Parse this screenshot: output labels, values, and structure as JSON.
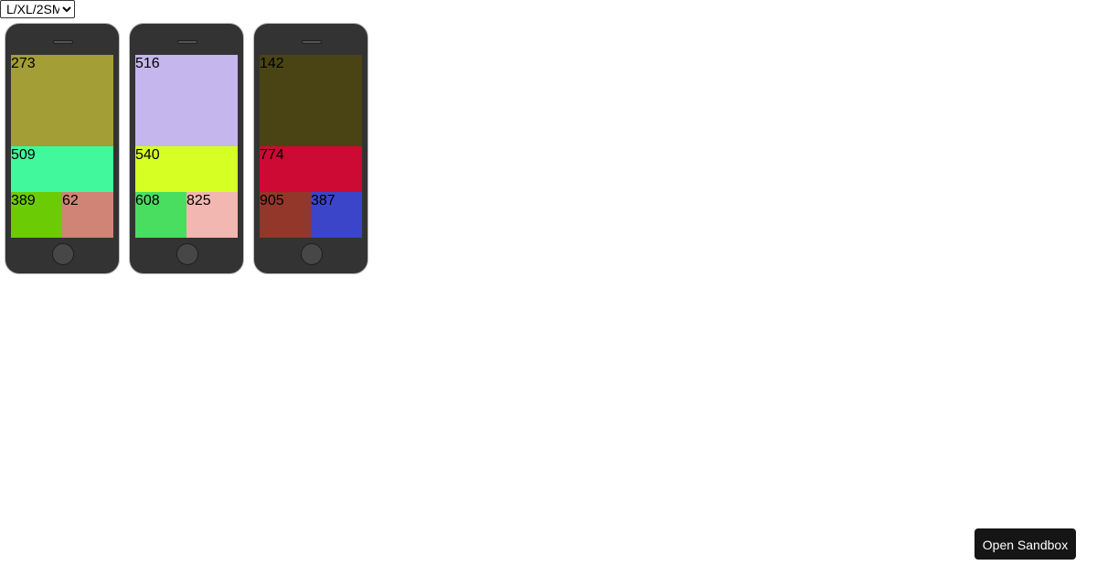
{
  "layout_select": {
    "value": "L/XL/2SM",
    "options": [
      "L/XL/2SM"
    ]
  },
  "phones": [
    {
      "tiles": [
        {
          "label": "273",
          "color": "#a39e35"
        },
        {
          "label": "509",
          "color": "#41f99c"
        },
        {
          "label": "389",
          "color": "#6bcb05"
        },
        {
          "label": "62",
          "color": "#cf8475"
        }
      ]
    },
    {
      "tiles": [
        {
          "label": "516",
          "color": "#c5b6ee"
        },
        {
          "label": "540",
          "color": "#d6ff23"
        },
        {
          "label": "608",
          "color": "#4ade60"
        },
        {
          "label": "825",
          "color": "#f1b7b0"
        }
      ]
    },
    {
      "tiles": [
        {
          "label": "142",
          "color": "#4a4414"
        },
        {
          "label": "774",
          "color": "#cc0a33"
        },
        {
          "label": "905",
          "color": "#923729"
        },
        {
          "label": "387",
          "color": "#3a45c9"
        }
      ]
    }
  ],
  "open_sandbox_label": "Open Sandbox"
}
